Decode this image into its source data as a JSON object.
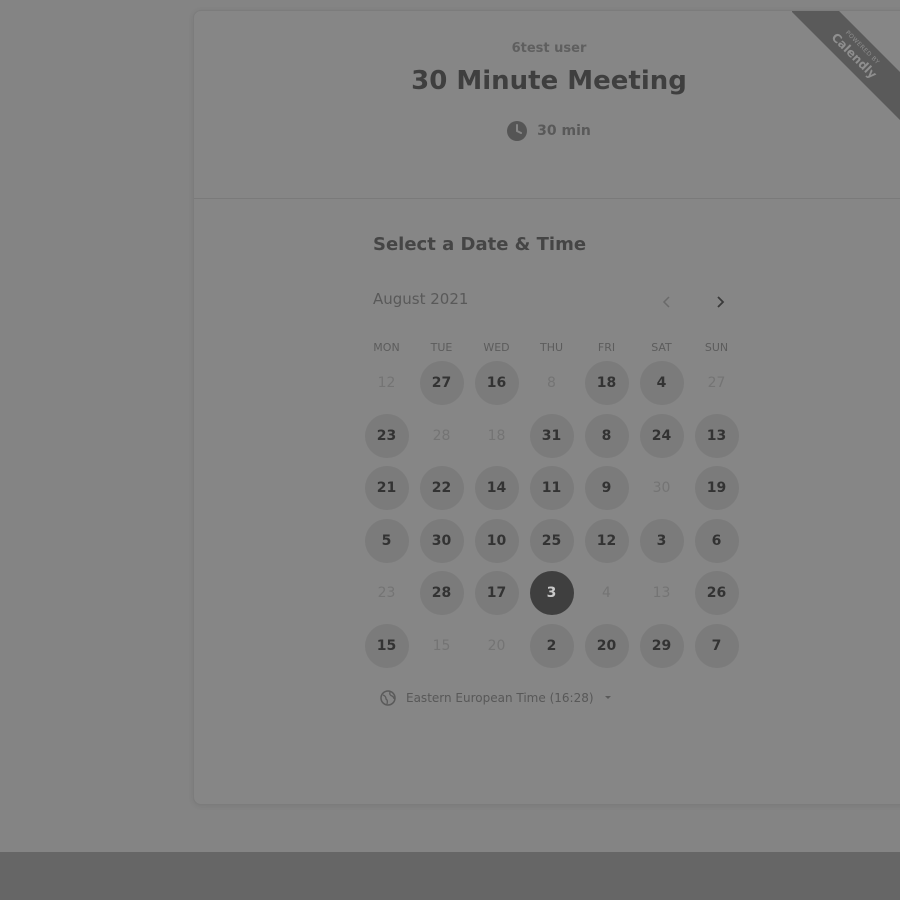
{
  "header": {
    "owner": "6test user",
    "title": "30 Minute Meeting",
    "duration": "30 min",
    "duration_icon": "clock-icon"
  },
  "ribbon": {
    "small": "POWERED BY",
    "brand": "Calendly"
  },
  "picker": {
    "title": "Select a Date & Time",
    "month": "August 2021",
    "prev_icon": "chevron-left-icon",
    "next_icon": "chevron-right-icon",
    "weekdays": [
      "MON",
      "TUE",
      "WED",
      "THU",
      "FRI",
      "SAT",
      "SUN"
    ],
    "days": [
      [
        {
          "label": "12",
          "state": "unavailable"
        },
        {
          "label": "27",
          "state": "available"
        },
        {
          "label": "16",
          "state": "available"
        },
        {
          "label": "8",
          "state": "unavailable"
        },
        {
          "label": "18",
          "state": "available"
        },
        {
          "label": "4",
          "state": "available"
        },
        {
          "label": "27",
          "state": "unavailable"
        }
      ],
      [
        {
          "label": "23",
          "state": "available"
        },
        {
          "label": "28",
          "state": "unavailable"
        },
        {
          "label": "18",
          "state": "unavailable"
        },
        {
          "label": "31",
          "state": "available"
        },
        {
          "label": "8",
          "state": "available"
        },
        {
          "label": "24",
          "state": "available"
        },
        {
          "label": "13",
          "state": "available"
        }
      ],
      [
        {
          "label": "21",
          "state": "available"
        },
        {
          "label": "22",
          "state": "available"
        },
        {
          "label": "14",
          "state": "available"
        },
        {
          "label": "11",
          "state": "available"
        },
        {
          "label": "9",
          "state": "available"
        },
        {
          "label": "30",
          "state": "unavailable"
        },
        {
          "label": "19",
          "state": "available"
        }
      ],
      [
        {
          "label": "5",
          "state": "available"
        },
        {
          "label": "30",
          "state": "available"
        },
        {
          "label": "10",
          "state": "available"
        },
        {
          "label": "25",
          "state": "available"
        },
        {
          "label": "12",
          "state": "available"
        },
        {
          "label": "3",
          "state": "available"
        },
        {
          "label": "6",
          "state": "available"
        }
      ],
      [
        {
          "label": "23",
          "state": "unavailable"
        },
        {
          "label": "28",
          "state": "available"
        },
        {
          "label": "17",
          "state": "available"
        },
        {
          "label": "3",
          "state": "selected"
        },
        {
          "label": "4",
          "state": "unavailable"
        },
        {
          "label": "13",
          "state": "unavailable"
        },
        {
          "label": "26",
          "state": "available"
        }
      ],
      [
        {
          "label": "15",
          "state": "available"
        },
        {
          "label": "15",
          "state": "unavailable"
        },
        {
          "label": "20",
          "state": "unavailable"
        },
        {
          "label": "2",
          "state": "available"
        },
        {
          "label": "20",
          "state": "available"
        },
        {
          "label": "29",
          "state": "available"
        },
        {
          "label": "7",
          "state": "available"
        }
      ]
    ],
    "timezone": "Eastern European Time (16:28)",
    "timezone_icon": "globe-icon"
  }
}
